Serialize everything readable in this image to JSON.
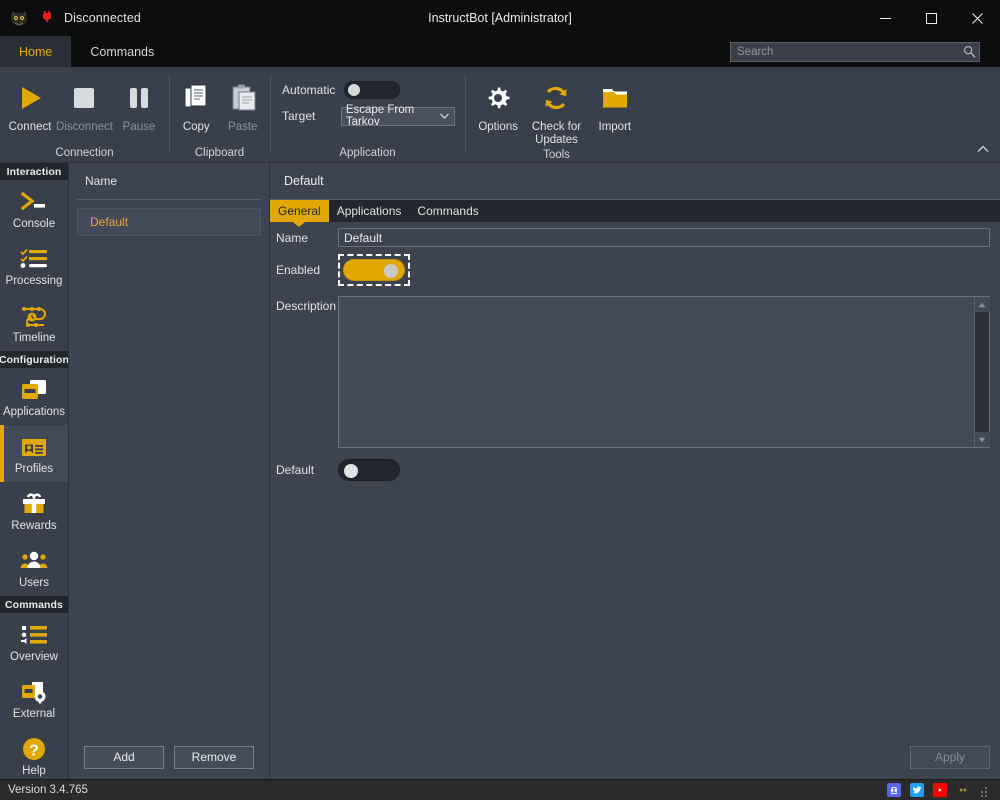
{
  "window": {
    "status_text": "Disconnected",
    "title": "InstructBot [Administrator]",
    "minimize_label": "—",
    "maximize_label": "□",
    "close_label": "✕",
    "logo_icon": "instructbot-logo-icon",
    "plug_icon": "disconnected-plug-icon"
  },
  "ribbon": {
    "tabs": [
      {
        "label": "Home",
        "active": true
      },
      {
        "label": "Commands",
        "active": false
      }
    ],
    "search": {
      "placeholder": "Search",
      "value": "",
      "icon": "search-icon"
    },
    "collapse_icon": "chevron-up-icon",
    "groups": [
      {
        "label": "Connection",
        "buttons": [
          {
            "label": "Connect",
            "icon": "play-icon",
            "disabled": false
          },
          {
            "label": "Disconnect",
            "icon": "stop-icon",
            "disabled": true
          },
          {
            "label": "Pause",
            "icon": "pause-icon",
            "disabled": true
          }
        ]
      },
      {
        "label": "Clipboard",
        "buttons": [
          {
            "label": "Copy",
            "icon": "copy-icon",
            "disabled": false
          },
          {
            "label": "Paste",
            "icon": "paste-icon",
            "disabled": true
          }
        ]
      },
      {
        "label": "Application",
        "automatic_label": "Automatic",
        "automatic_on": false,
        "target_label": "Target",
        "target_value": "Escape From Tarkov",
        "target_caret_icon": "chevron-down-icon"
      },
      {
        "label": "Tools",
        "buttons": [
          {
            "label": "Options",
            "icon": "gear-icon",
            "disabled": false
          },
          {
            "label": "Check for Updates",
            "icon": "refresh-icon",
            "disabled": false
          },
          {
            "label": "Import",
            "icon": "folder-open-icon",
            "disabled": false
          }
        ]
      }
    ]
  },
  "sidebar": {
    "sections": [
      {
        "header": "Interaction",
        "items": [
          {
            "label": "Console",
            "icon": "console-prompt-icon",
            "selected": false
          },
          {
            "label": "Processing",
            "icon": "checklist-icon",
            "selected": false
          },
          {
            "label": "Timeline",
            "icon": "timeline-icon",
            "selected": false
          }
        ]
      },
      {
        "header": "Configuration",
        "items": [
          {
            "label": "Applications",
            "icon": "applications-icon",
            "selected": false
          },
          {
            "label": "Profiles",
            "icon": "profile-card-icon",
            "selected": true
          },
          {
            "label": "Rewards",
            "icon": "gift-icon",
            "selected": false
          },
          {
            "label": "Users",
            "icon": "users-icon",
            "selected": false
          }
        ]
      },
      {
        "header": "Commands",
        "items": [
          {
            "label": "Overview",
            "icon": "overview-list-icon",
            "selected": false
          },
          {
            "label": "External",
            "icon": "external-gear-icon",
            "selected": false
          },
          {
            "label": "Help",
            "icon": "help-question-icon",
            "selected": false
          }
        ]
      }
    ]
  },
  "list_pane": {
    "column_header": "Name",
    "rows": [
      {
        "name": "Default",
        "selected": true
      }
    ],
    "add_label": "Add",
    "remove_label": "Remove"
  },
  "detail": {
    "title": "Default",
    "tabs": [
      {
        "label": "General",
        "active": true
      },
      {
        "label": "Applications",
        "active": false
      },
      {
        "label": "Commands",
        "active": false
      }
    ],
    "fields": {
      "name_label": "Name",
      "name_value": "Default",
      "name_placeholder": "",
      "enabled_label": "Enabled",
      "enabled_on": true,
      "enabled_focused": true,
      "description_label": "Description",
      "description_value": "",
      "description_placeholder": "",
      "default_label": "Default",
      "default_on": false
    },
    "scroll_up_icon": "scroll-up-arrow-icon",
    "scroll_down_icon": "scroll-down-arrow-icon",
    "apply_label": "Apply",
    "apply_disabled": true
  },
  "statusbar": {
    "version": "Version 3.4.765",
    "icons": [
      {
        "name": "discord-icon",
        "color": "#5865F2"
      },
      {
        "name": "twitter-icon",
        "color": "#1DA1F2"
      },
      {
        "name": "youtube-icon",
        "color": "#FF0000"
      },
      {
        "name": "instructbot-logo-icon",
        "color": "#d8b84a"
      }
    ],
    "resize_grip_icon": "resize-grip-icon"
  },
  "colors": {
    "accent": "#e0a800",
    "window_bg": "#3d4450",
    "ribbon_bg": "#3a404b",
    "titlebar_bg": "#0d0d0d",
    "statusbar_bg": "#2b2b2b",
    "selected_row_text": "#e8a33d"
  }
}
